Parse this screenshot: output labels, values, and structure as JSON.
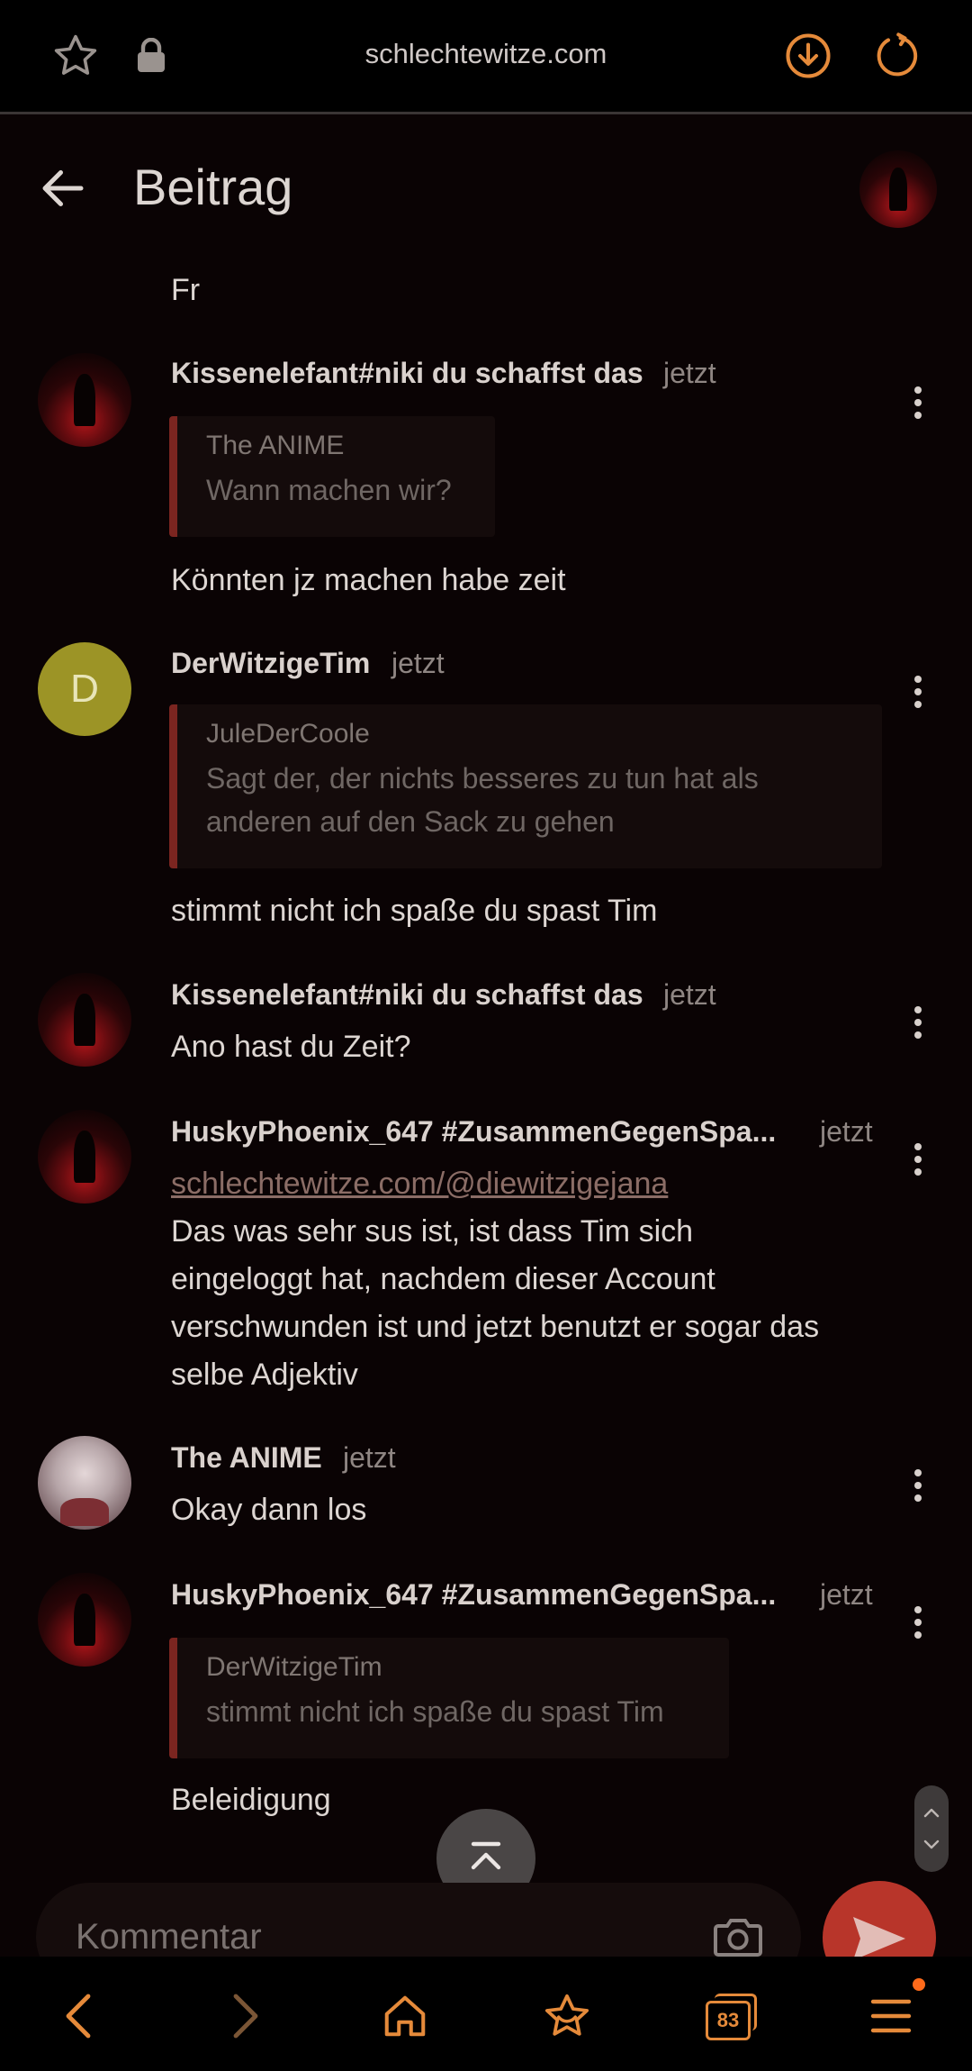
{
  "browser": {
    "url": "schlechtewitze.com",
    "tab_count": "83"
  },
  "header": {
    "title": "Beitrag"
  },
  "top_fragment": "Fr",
  "comments": [
    {
      "author": "Kissenelefant#niki du schaffst das",
      "time": "jetzt",
      "quote": {
        "author": "The ANIME",
        "text": "Wann machen wir?"
      },
      "text": "Könnten jz machen habe zeit"
    },
    {
      "author": "DerWitzigeTim",
      "time": "jetzt",
      "avatar_letter": "D",
      "quote": {
        "author": "JuleDerCoole",
        "text_line1": "Sagt der, der nichts besseres zu tun hat als",
        "text_line2": "anderen auf den Sack zu gehen"
      },
      "text": "stimmt nicht ich spaße du spast Tim"
    },
    {
      "author": "Kissenelefant#niki du schaffst das",
      "time": "jetzt",
      "text": "Ano hast du Zeit?"
    },
    {
      "author": "HuskyPhoenix_647 #ZusammenGegenSpa...",
      "time": "jetzt",
      "link": "schlechtewitze.com/@diewitzigejana",
      "text_lines": [
        "Das was sehr sus ist, ist dass Tim sich",
        "eingeloggt hat, nachdem dieser Account",
        "verschwunden ist und jetzt benutzt er sogar das",
        "selbe Adjektiv"
      ]
    },
    {
      "author": "The ANIME",
      "time": "jetzt",
      "text": "Okay dann los"
    },
    {
      "author": "HuskyPhoenix_647 #ZusammenGegenSpa...",
      "time": "jetzt",
      "quote": {
        "author": "DerWitzigeTim",
        "text": "stimmt nicht ich spaße du spast Tim"
      },
      "text": "Beleidigung"
    }
  ],
  "composer": {
    "placeholder": "Kommentar"
  },
  "colors": {
    "background": "#0a0304",
    "accent": "#e58a3a",
    "quote_bar": "#7b2520",
    "send_button": "#b8352a"
  }
}
